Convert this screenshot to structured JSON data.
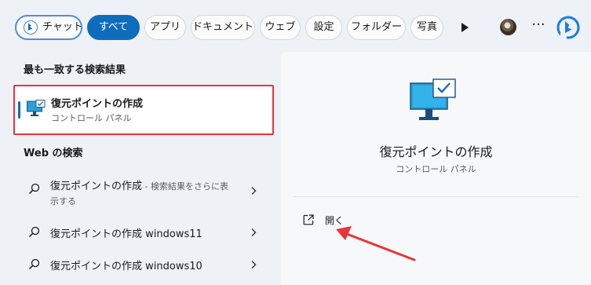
{
  "filters": {
    "chat": "チャット",
    "all": "すべて",
    "apps": "アプリ",
    "documents": "ドキュメント",
    "web": "ウェブ",
    "settings": "設定",
    "folders": "フォルダー",
    "photos": "写真"
  },
  "best_match": {
    "heading": "最も一致する検索結果",
    "title": "復元ポイントの作成",
    "subtitle": "コントロール パネル"
  },
  "web_search": {
    "heading": "Web の検索",
    "results": [
      {
        "text": "復元ポイントの作成",
        "hint": " - 検索結果をさらに表",
        "hint2": "示する"
      },
      {
        "text": "復元ポイントの作成 windows11"
      },
      {
        "text": "復元ポイントの作成 windows10"
      }
    ]
  },
  "preview": {
    "title": "復元ポイントの作成",
    "subtitle": "コントロール パネル",
    "open_label": "開く"
  },
  "colors": {
    "accent": "#0f6cbd",
    "highlight_border": "#e8353a",
    "annotation_arrow": "#e8353a"
  },
  "icons": {
    "chat": "bing-chat-icon",
    "more": "play-icon",
    "menu": "ellipsis-icon",
    "bing": "bing-icon",
    "result": "monitor-check-icon",
    "search": "search-icon",
    "open": "external-link-icon"
  }
}
